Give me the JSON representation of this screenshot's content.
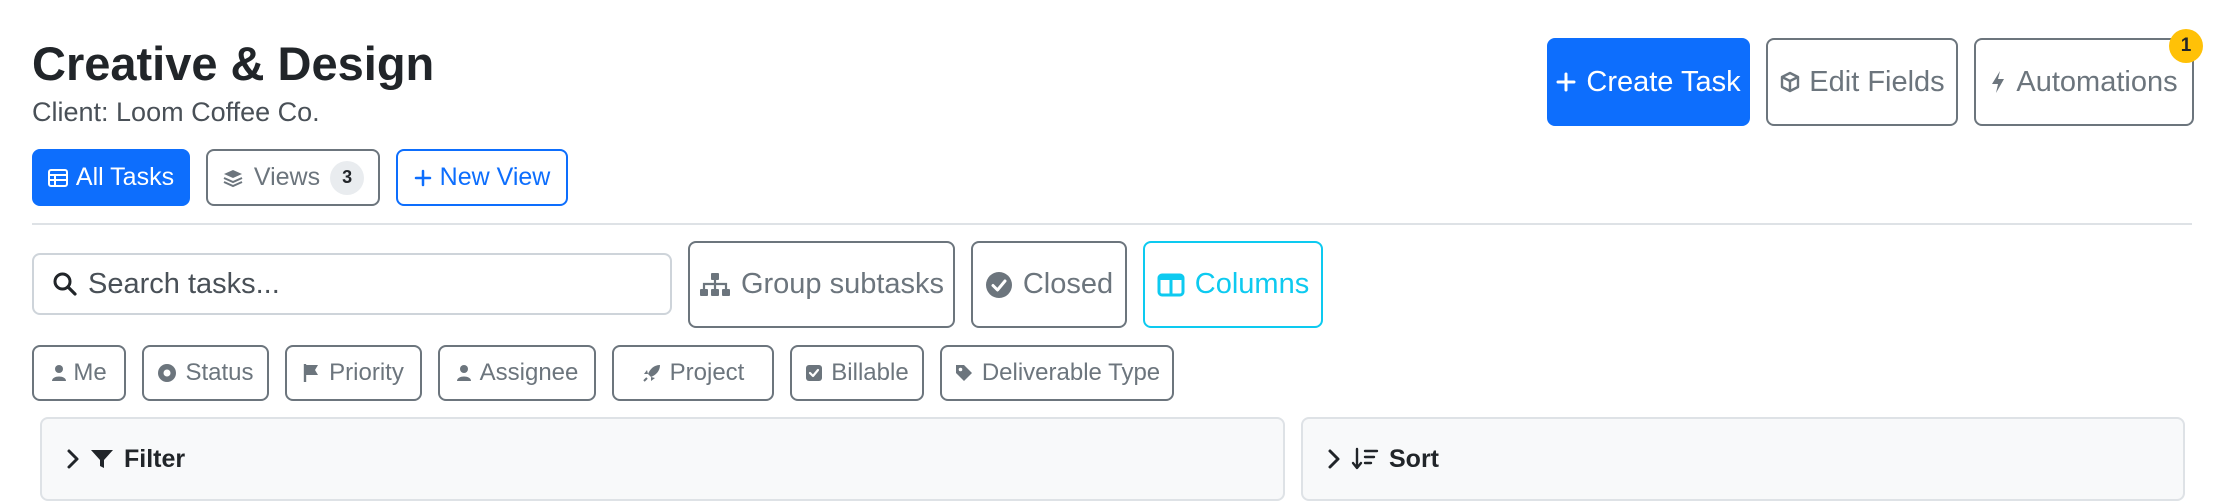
{
  "header": {
    "title": "Creative & Design",
    "subtitle": "Client: Loom Coffee Co."
  },
  "actions": {
    "create_task": "Create Task",
    "edit_fields": "Edit Fields",
    "automations": "Automations",
    "automations_badge": "1"
  },
  "views": {
    "all_tasks": "All Tasks",
    "views_label": "Views",
    "views_count": "3",
    "new_view": "New View"
  },
  "toolbar": {
    "search_placeholder": "Search tasks...",
    "group_subtasks": "Group subtasks",
    "closed": "Closed",
    "columns": "Columns"
  },
  "filter_chips": [
    "Me",
    "Status",
    "Priority",
    "Assignee",
    "Project",
    "Billable",
    "Deliverable Type"
  ],
  "panels": {
    "filter": "Filter",
    "sort": "Sort"
  },
  "colors": {
    "primary": "#0d6efd",
    "secondary": "#6c757d",
    "info": "#0dcaf0",
    "warning": "#ffc107"
  },
  "icons": [
    "plus-icon",
    "box-icon",
    "bolt-icon",
    "table-icon",
    "layers-icon",
    "search-icon",
    "sitemap-icon",
    "check-circle-icon",
    "columns-icon",
    "user-icon",
    "dot-circle-icon",
    "flag-icon",
    "rocket-icon",
    "check-square-icon",
    "tag-icon",
    "chevron-right-icon",
    "filter-icon",
    "sort-icon"
  ]
}
